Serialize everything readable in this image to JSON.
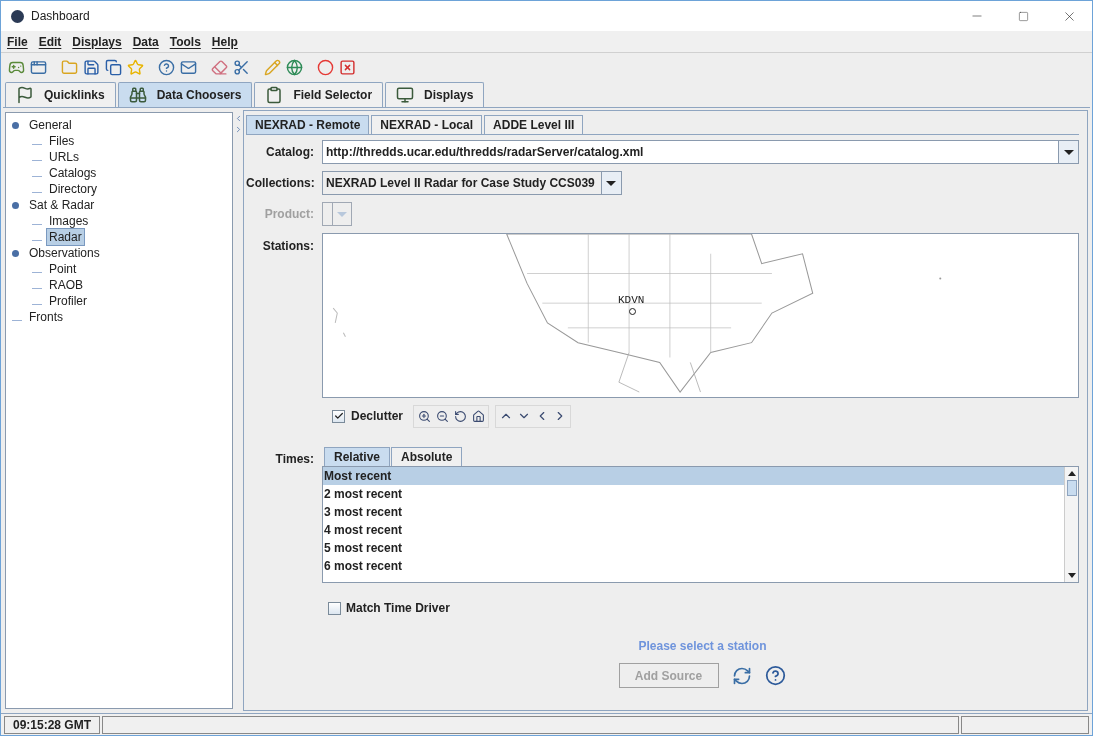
{
  "window": {
    "title": "Dashboard"
  },
  "menu": [
    "File",
    "Edit",
    "Displays",
    "Data",
    "Tools",
    "Help"
  ],
  "main_tabs": [
    {
      "label": "Quicklinks",
      "selected": false
    },
    {
      "label": "Data Choosers",
      "selected": true
    },
    {
      "label": "Field Selector",
      "selected": false
    },
    {
      "label": "Displays",
      "selected": false
    }
  ],
  "tree": [
    {
      "label": "General",
      "selected": false,
      "children": [
        {
          "label": "Files",
          "selected": false
        },
        {
          "label": "URLs",
          "selected": false
        },
        {
          "label": "Catalogs",
          "selected": false
        },
        {
          "label": "Directory",
          "selected": false
        }
      ]
    },
    {
      "label": "Sat & Radar",
      "selected": false,
      "children": [
        {
          "label": "Images",
          "selected": false
        },
        {
          "label": "Radar",
          "selected": true
        }
      ]
    },
    {
      "label": "Observations",
      "selected": false,
      "children": [
        {
          "label": "Point",
          "selected": false
        },
        {
          "label": "RAOB",
          "selected": false
        },
        {
          "label": "Profiler",
          "selected": false
        }
      ]
    },
    {
      "label": "Fronts",
      "selected": false
    }
  ],
  "chooser_tabs": [
    {
      "label": "NEXRAD - Remote",
      "selected": true
    },
    {
      "label": "NEXRAD - Local",
      "selected": false
    },
    {
      "label": "ADDE Level III",
      "selected": false
    }
  ],
  "catalog": {
    "label": "Catalog:",
    "value": "http://thredds.ucar.edu/thredds/radarServer/catalog.xml"
  },
  "collections": {
    "label": "Collections:",
    "value": "NEXRAD Level II Radar for Case Study CCS039"
  },
  "product": {
    "label": "Product:",
    "disabled": true
  },
  "stations": {
    "label": "Stations:",
    "marker": "KDVN"
  },
  "declutter": {
    "label": "Declutter",
    "checked": true
  },
  "times": {
    "label": "Times:",
    "tabs": [
      {
        "label": "Relative",
        "selected": true
      },
      {
        "label": "Absolute",
        "selected": false
      }
    ],
    "rows": [
      {
        "label": "Most recent",
        "selected": true
      },
      {
        "label": "2 most recent",
        "selected": false
      },
      {
        "label": "3 most recent",
        "selected": false
      },
      {
        "label": "4 most recent",
        "selected": false
      },
      {
        "label": "5 most recent",
        "selected": false
      },
      {
        "label": "6 most recent",
        "selected": false
      }
    ]
  },
  "match_time_driver": {
    "label": "Match Time Driver",
    "checked": false
  },
  "message": "Please select a station",
  "add_source": {
    "label": "Add Source",
    "disabled": true
  },
  "status_bar": {
    "time": "09:15:28 GMT"
  }
}
